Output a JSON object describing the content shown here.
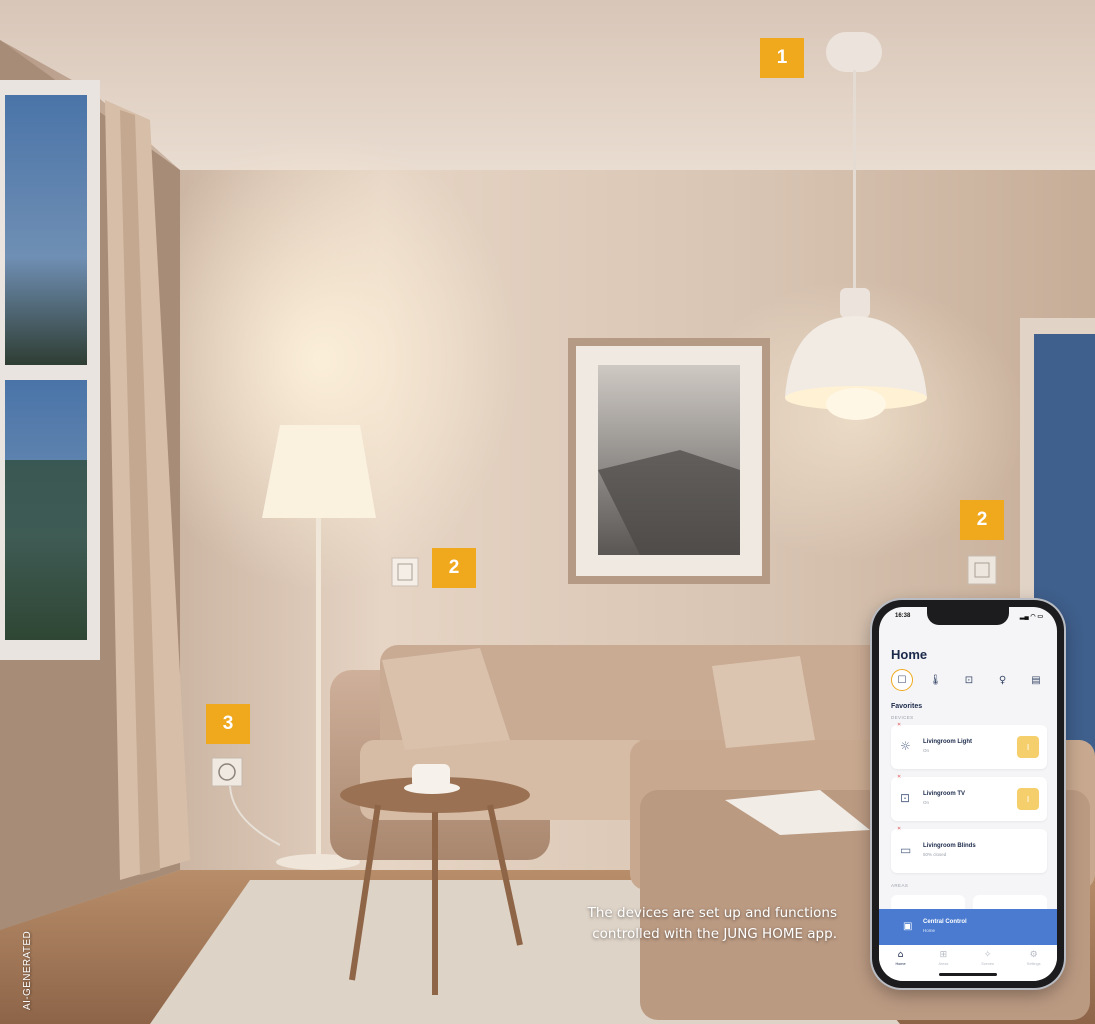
{
  "markers": {
    "ceiling_light": "1",
    "switch_left": "2",
    "switch_right": "2",
    "socket": "3"
  },
  "caption": "The devices are set up and functions controlled with the JUNG HOME app.",
  "ai_label": "AI-GENERATED",
  "colors": {
    "marker": "#f0a81c",
    "app_primary": "#4a7bd0",
    "app_toggle": "#f5cf6b"
  },
  "phone": {
    "status_time": "16:38",
    "title": "Home",
    "categories": [
      "favorites-icon",
      "thermometer-icon",
      "socket-icon",
      "bulb-icon",
      "blinds-icon"
    ],
    "favorites_title": "Favorites",
    "devices_label": "DEVICES",
    "devices": [
      {
        "name": "Livingroom Light",
        "state": "On",
        "icon": "bulb-icon",
        "toggle": "I"
      },
      {
        "name": "Livingroom TV",
        "state": "On",
        "icon": "socket-icon",
        "toggle": "I"
      },
      {
        "name": "Livingroom Blinds",
        "state": "50% closed",
        "icon": "blinds-icon"
      }
    ],
    "areas_label": "AREAS",
    "central": {
      "name": "Central Control",
      "state": "Home"
    },
    "tabs": [
      {
        "label": "Home",
        "icon": "home-icon"
      },
      {
        "label": "Areas",
        "icon": "areas-icon"
      },
      {
        "label": "Scenes",
        "icon": "scenes-icon"
      },
      {
        "label": "Settings",
        "icon": "settings-icon"
      }
    ]
  }
}
